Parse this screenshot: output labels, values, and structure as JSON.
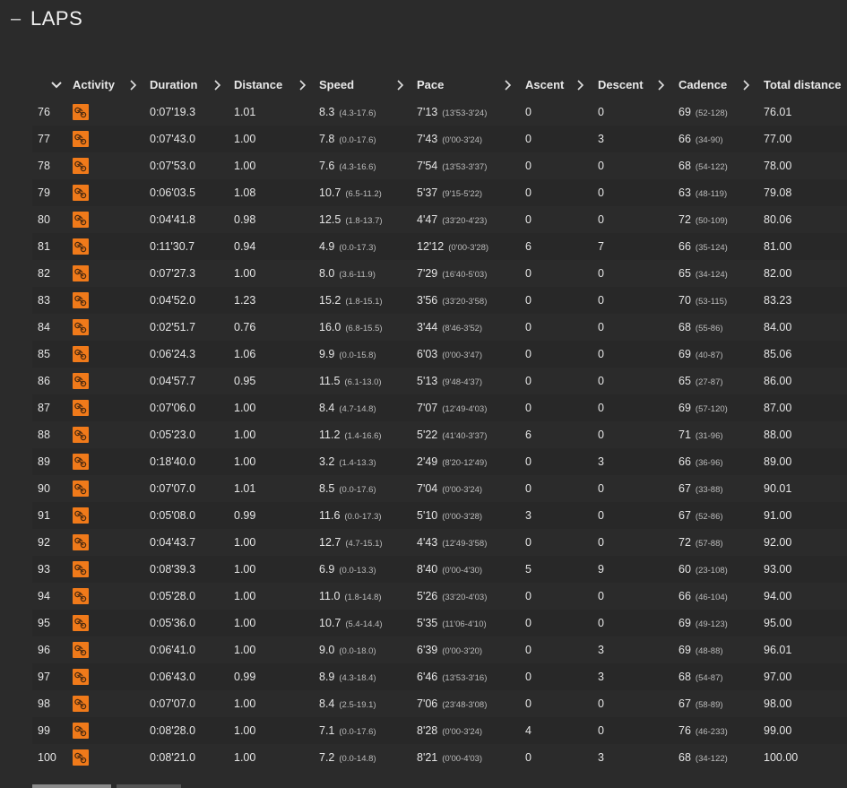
{
  "section": {
    "collapse_symbol": "–",
    "title": "LAPS"
  },
  "icons": {
    "activity": "cycling-activity-icon",
    "sort": "chevron-right-icon",
    "expand": "chevron-down-icon"
  },
  "colors": {
    "background": "#2b2b2b",
    "activity_badge": "#f07a1a"
  },
  "table": {
    "headers": {
      "activity": "Activity",
      "duration": "Duration",
      "distance": "Distance",
      "speed": "Speed",
      "pace": "Pace",
      "ascent": "Ascent",
      "descent": "Descent",
      "cadence": "Cadence",
      "total_distance": "Total distance"
    },
    "rows": [
      {
        "lap": "76",
        "duration": "0:07'19.3",
        "distance": "1.01",
        "speed": "8.3",
        "speed_range": "(4.3-17.6)",
        "pace": "7'13",
        "pace_range": "(13'53-3'24)",
        "ascent": "0",
        "descent": "0",
        "cadence": "69",
        "cadence_range": "(52-128)",
        "total": "76.01"
      },
      {
        "lap": "77",
        "duration": "0:07'43.0",
        "distance": "1.00",
        "speed": "7.8",
        "speed_range": "(0.0-17.6)",
        "pace": "7'43",
        "pace_range": "(0'00-3'24)",
        "ascent": "0",
        "descent": "3",
        "cadence": "66",
        "cadence_range": "(34-90)",
        "total": "77.00"
      },
      {
        "lap": "78",
        "duration": "0:07'53.0",
        "distance": "1.00",
        "speed": "7.6",
        "speed_range": "(4.3-16.6)",
        "pace": "7'54",
        "pace_range": "(13'53-3'37)",
        "ascent": "0",
        "descent": "0",
        "cadence": "68",
        "cadence_range": "(54-122)",
        "total": "78.00"
      },
      {
        "lap": "79",
        "duration": "0:06'03.5",
        "distance": "1.08",
        "speed": "10.7",
        "speed_range": "(6.5-11.2)",
        "pace": "5'37",
        "pace_range": "(9'15-5'22)",
        "ascent": "0",
        "descent": "0",
        "cadence": "63",
        "cadence_range": "(48-119)",
        "total": "79.08"
      },
      {
        "lap": "80",
        "duration": "0:04'41.8",
        "distance": "0.98",
        "speed": "12.5",
        "speed_range": "(1.8-13.7)",
        "pace": "4'47",
        "pace_range": "(33'20-4'23)",
        "ascent": "0",
        "descent": "0",
        "cadence": "72",
        "cadence_range": "(50-109)",
        "total": "80.06"
      },
      {
        "lap": "81",
        "duration": "0:11'30.7",
        "distance": "0.94",
        "speed": "4.9",
        "speed_range": "(0.0-17.3)",
        "pace": "12'12",
        "pace_range": "(0'00-3'28)",
        "ascent": "6",
        "descent": "7",
        "cadence": "66",
        "cadence_range": "(35-124)",
        "total": "81.00"
      },
      {
        "lap": "82",
        "duration": "0:07'27.3",
        "distance": "1.00",
        "speed": "8.0",
        "speed_range": "(3.6-11.9)",
        "pace": "7'29",
        "pace_range": "(16'40-5'03)",
        "ascent": "0",
        "descent": "0",
        "cadence": "65",
        "cadence_range": "(34-124)",
        "total": "82.00"
      },
      {
        "lap": "83",
        "duration": "0:04'52.0",
        "distance": "1.23",
        "speed": "15.2",
        "speed_range": "(1.8-15.1)",
        "pace": "3'56",
        "pace_range": "(33'20-3'58)",
        "ascent": "0",
        "descent": "0",
        "cadence": "70",
        "cadence_range": "(53-115)",
        "total": "83.23"
      },
      {
        "lap": "84",
        "duration": "0:02'51.7",
        "distance": "0.76",
        "speed": "16.0",
        "speed_range": "(6.8-15.5)",
        "pace": "3'44",
        "pace_range": "(8'46-3'52)",
        "ascent": "0",
        "descent": "0",
        "cadence": "68",
        "cadence_range": "(55-86)",
        "total": "84.00"
      },
      {
        "lap": "85",
        "duration": "0:06'24.3",
        "distance": "1.06",
        "speed": "9.9",
        "speed_range": "(0.0-15.8)",
        "pace": "6'03",
        "pace_range": "(0'00-3'47)",
        "ascent": "0",
        "descent": "0",
        "cadence": "69",
        "cadence_range": "(40-87)",
        "total": "85.06"
      },
      {
        "lap": "86",
        "duration": "0:04'57.7",
        "distance": "0.95",
        "speed": "11.5",
        "speed_range": "(6.1-13.0)",
        "pace": "5'13",
        "pace_range": "(9'48-4'37)",
        "ascent": "0",
        "descent": "0",
        "cadence": "65",
        "cadence_range": "(27-87)",
        "total": "86.00"
      },
      {
        "lap": "87",
        "duration": "0:07'06.0",
        "distance": "1.00",
        "speed": "8.4",
        "speed_range": "(4.7-14.8)",
        "pace": "7'07",
        "pace_range": "(12'49-4'03)",
        "ascent": "0",
        "descent": "0",
        "cadence": "69",
        "cadence_range": "(57-120)",
        "total": "87.00"
      },
      {
        "lap": "88",
        "duration": "0:05'23.0",
        "distance": "1.00",
        "speed": "11.2",
        "speed_range": "(1.4-16.6)",
        "pace": "5'22",
        "pace_range": "(41'40-3'37)",
        "ascent": "6",
        "descent": "0",
        "cadence": "71",
        "cadence_range": "(31-96)",
        "total": "88.00"
      },
      {
        "lap": "89",
        "duration": "0:18'40.0",
        "distance": "1.00",
        "speed": "3.2",
        "speed_range": "(1.4-13.3)",
        "pace": "2'49",
        "pace_range": "(8'20-12'49)",
        "ascent": "0",
        "descent": "3",
        "cadence": "66",
        "cadence_range": "(36-96)",
        "total": "89.00"
      },
      {
        "lap": "90",
        "duration": "0:07'07.0",
        "distance": "1.01",
        "speed": "8.5",
        "speed_range": "(0.0-17.6)",
        "pace": "7'04",
        "pace_range": "(0'00-3'24)",
        "ascent": "0",
        "descent": "0",
        "cadence": "67",
        "cadence_range": "(33-88)",
        "total": "90.01"
      },
      {
        "lap": "91",
        "duration": "0:05'08.0",
        "distance": "0.99",
        "speed": "11.6",
        "speed_range": "(0.0-17.3)",
        "pace": "5'10",
        "pace_range": "(0'00-3'28)",
        "ascent": "3",
        "descent": "0",
        "cadence": "67",
        "cadence_range": "(52-86)",
        "total": "91.00"
      },
      {
        "lap": "92",
        "duration": "0:04'43.7",
        "distance": "1.00",
        "speed": "12.7",
        "speed_range": "(4.7-15.1)",
        "pace": "4'43",
        "pace_range": "(12'49-3'58)",
        "ascent": "0",
        "descent": "0",
        "cadence": "72",
        "cadence_range": "(57-88)",
        "total": "92.00"
      },
      {
        "lap": "93",
        "duration": "0:08'39.3",
        "distance": "1.00",
        "speed": "6.9",
        "speed_range": "(0.0-13.3)",
        "pace": "8'40",
        "pace_range": "(0'00-4'30)",
        "ascent": "5",
        "descent": "9",
        "cadence": "60",
        "cadence_range": "(23-108)",
        "total": "93.00"
      },
      {
        "lap": "94",
        "duration": "0:05'28.0",
        "distance": "1.00",
        "speed": "11.0",
        "speed_range": "(1.8-14.8)",
        "pace": "5'26",
        "pace_range": "(33'20-4'03)",
        "ascent": "0",
        "descent": "0",
        "cadence": "66",
        "cadence_range": "(46-104)",
        "total": "94.00"
      },
      {
        "lap": "95",
        "duration": "0:05'36.0",
        "distance": "1.00",
        "speed": "10.7",
        "speed_range": "(5.4-14.4)",
        "pace": "5'35",
        "pace_range": "(11'06-4'10)",
        "ascent": "0",
        "descent": "0",
        "cadence": "69",
        "cadence_range": "(49-123)",
        "total": "95.00"
      },
      {
        "lap": "96",
        "duration": "0:06'41.0",
        "distance": "1.00",
        "speed": "9.0",
        "speed_range": "(0.0-18.0)",
        "pace": "6'39",
        "pace_range": "(0'00-3'20)",
        "ascent": "0",
        "descent": "3",
        "cadence": "69",
        "cadence_range": "(48-88)",
        "total": "96.01"
      },
      {
        "lap": "97",
        "duration": "0:06'43.0",
        "distance": "0.99",
        "speed": "8.9",
        "speed_range": "(4.3-18.4)",
        "pace": "6'46",
        "pace_range": "(13'53-3'16)",
        "ascent": "0",
        "descent": "3",
        "cadence": "68",
        "cadence_range": "(54-87)",
        "total": "97.00"
      },
      {
        "lap": "98",
        "duration": "0:07'07.0",
        "distance": "1.00",
        "speed": "8.4",
        "speed_range": "(2.5-19.1)",
        "pace": "7'06",
        "pace_range": "(23'48-3'08)",
        "ascent": "0",
        "descent": "0",
        "cadence": "67",
        "cadence_range": "(58-89)",
        "total": "98.00"
      },
      {
        "lap": "99",
        "duration": "0:08'28.0",
        "distance": "1.00",
        "speed": "7.1",
        "speed_range": "(0.0-17.6)",
        "pace": "8'28",
        "pace_range": "(0'00-3'24)",
        "ascent": "4",
        "descent": "0",
        "cadence": "76",
        "cadence_range": "(46-233)",
        "total": "99.00"
      },
      {
        "lap": "100",
        "duration": "0:08'21.0",
        "distance": "1.00",
        "speed": "7.2",
        "speed_range": "(0.0-14.8)",
        "pace": "8'21",
        "pace_range": "(0'00-4'03)",
        "ascent": "0",
        "descent": "3",
        "cadence": "68",
        "cadence_range": "(34-122)",
        "total": "100.00"
      }
    ]
  }
}
